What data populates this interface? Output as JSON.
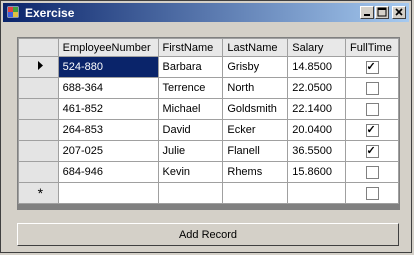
{
  "window": {
    "title": "Exercise"
  },
  "grid": {
    "columns": [
      "EmployeeNumber",
      "FirstName",
      "LastName",
      "Salary",
      "FullTime"
    ],
    "rows": [
      {
        "marker": "current",
        "EmployeeNumber": "524-880",
        "FirstName": "Barbara",
        "LastName": "Grisby",
        "Salary": "14.8500",
        "FullTime": true
      },
      {
        "marker": "",
        "EmployeeNumber": "688-364",
        "FirstName": "Terrence",
        "LastName": "North",
        "Salary": "22.0500",
        "FullTime": false
      },
      {
        "marker": "",
        "EmployeeNumber": "461-852",
        "FirstName": "Michael",
        "LastName": "Goldsmith",
        "Salary": "22.1400",
        "FullTime": false
      },
      {
        "marker": "",
        "EmployeeNumber": "264-853",
        "FirstName": "David",
        "LastName": "Ecker",
        "Salary": "20.0400",
        "FullTime": true
      },
      {
        "marker": "",
        "EmployeeNumber": "207-025",
        "FirstName": "Julie",
        "LastName": "Flanell",
        "Salary": "36.5500",
        "FullTime": true
      },
      {
        "marker": "",
        "EmployeeNumber": "684-946",
        "FirstName": "Kevin",
        "LastName": "Rhems",
        "Salary": "15.8600",
        "FullTime": false
      }
    ],
    "new_row_marker": "*"
  },
  "actions": {
    "add_record": "Add Record"
  }
}
